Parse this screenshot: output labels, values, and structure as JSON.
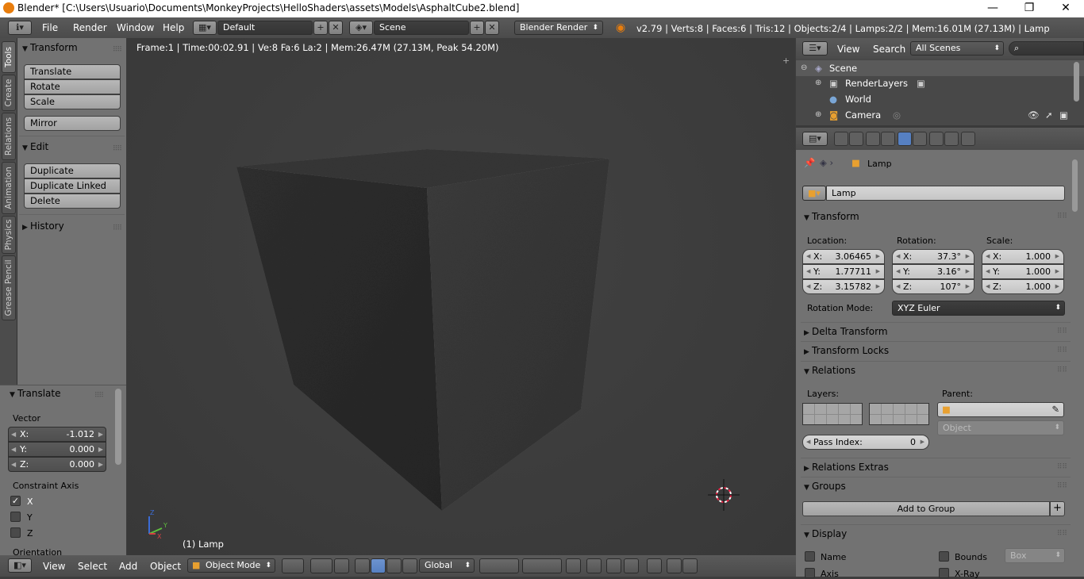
{
  "window": {
    "title": "Blender* [C:\\Users\\Usuario\\Documents\\MonkeyProjects\\HelloShaders\\assets\\Models\\AsphaltCube2.blend]",
    "controls": [
      "—",
      "❐",
      "✕"
    ]
  },
  "topbar": {
    "menus": [
      "File",
      "Render",
      "Window",
      "Help"
    ],
    "screen_layout": "Default",
    "scene": "Scene",
    "render_engine": "Blender Render",
    "stats": "v2.79 | Verts:8 | Faces:6 | Tris:12 | Objects:2/4 | Lamps:2/2 | Mem:16.01M (27.13M) | Lamp"
  },
  "toolshelf": {
    "tabs": [
      "Tools",
      "Create",
      "Relations",
      "Animation",
      "Physics",
      "Grease Pencil"
    ],
    "transform_panel": {
      "title": "Transform",
      "buttons": [
        "Translate",
        "Rotate",
        "Scale"
      ],
      "mirror": "Mirror"
    },
    "edit_panel": {
      "title": "Edit",
      "buttons": [
        "Duplicate",
        "Duplicate Linked",
        "Delete"
      ]
    },
    "history_panel": {
      "title": "History"
    }
  },
  "operator": {
    "title": "Translate",
    "vector_label": "Vector",
    "vector": [
      {
        "axis": "X:",
        "value": "-1.012"
      },
      {
        "axis": "Y:",
        "value": "0.000"
      },
      {
        "axis": "Z:",
        "value": "0.000"
      }
    ],
    "constraint_label": "Constraint Axis",
    "constraints": [
      {
        "label": "X",
        "checked": true
      },
      {
        "label": "Y",
        "checked": false
      },
      {
        "label": "Z",
        "checked": false
      }
    ],
    "orientation_label": "Orientation"
  },
  "viewport": {
    "info": "Frame:1 | Time:00:02.91 | Ve:8 Fa:6 La:2 | Mem:26.47M (27.13M, Peak 54.20M)",
    "object_name": "(1) Lamp"
  },
  "bottombar": {
    "menus": [
      "View",
      "Select",
      "Add",
      "Object"
    ],
    "mode": "Object Mode",
    "orientation": "Global"
  },
  "outliner": {
    "menus": [
      "View",
      "Search"
    ],
    "filter": "All Scenes",
    "items": [
      {
        "label": "Scene",
        "level": 0
      },
      {
        "label": "RenderLayers",
        "level": 1
      },
      {
        "label": "World",
        "level": 1
      },
      {
        "label": "Camera",
        "level": 1
      }
    ]
  },
  "properties": {
    "breadcrumb": "Lamp",
    "object_name": "Lamp",
    "transform": {
      "title": "Transform",
      "location_label": "Location:",
      "rotation_label": "Rotation:",
      "scale_label": "Scale:",
      "location": [
        {
          "axis": "X:",
          "value": "3.06465"
        },
        {
          "axis": "Y:",
          "value": "1.77711"
        },
        {
          "axis": "Z:",
          "value": "3.15782"
        }
      ],
      "rotation": [
        {
          "axis": "X:",
          "value": "37.3°"
        },
        {
          "axis": "Y:",
          "value": "3.16°"
        },
        {
          "axis": "Z:",
          "value": "107°"
        }
      ],
      "scale": [
        {
          "axis": "X:",
          "value": "1.000"
        },
        {
          "axis": "Y:",
          "value": "1.000"
        },
        {
          "axis": "Z:",
          "value": "1.000"
        }
      ],
      "rotation_mode_label": "Rotation Mode:",
      "rotation_mode": "XYZ Euler"
    },
    "delta_transform": "Delta Transform",
    "transform_locks": "Transform Locks",
    "relations": {
      "title": "Relations",
      "layers_label": "Layers:",
      "parent_label": "Parent:",
      "parent_type": "Object",
      "pass_index_label": "Pass Index:",
      "pass_index": "0"
    },
    "relations_extras": "Relations Extras",
    "groups": {
      "title": "Groups",
      "add_button": "Add to Group"
    },
    "display": {
      "title": "Display",
      "name": "Name",
      "axis": "Axis",
      "bounds": "Bounds",
      "bounds_type": "Box",
      "xray": "X-Ray"
    }
  }
}
